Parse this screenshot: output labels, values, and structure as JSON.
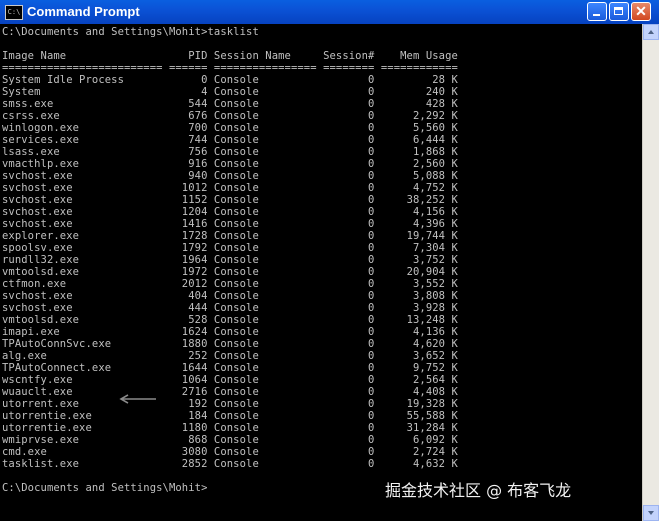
{
  "window": {
    "title": "Command Prompt",
    "icon_label": "C:\\",
    "icon": "cmd-icon"
  },
  "console": {
    "prompt_command": "C:\\Documents and Settings\\Mohit>tasklist",
    "blank": "",
    "header": "Image Name                   PID Session Name     Session#    Mem Usage",
    "separator": "========================= ====== ================ ======== ============",
    "rows": [
      {
        "image": "System Idle Process",
        "pid": "0",
        "session": "Console",
        "num": "0",
        "mem": "28 K"
      },
      {
        "image": "System",
        "pid": "4",
        "session": "Console",
        "num": "0",
        "mem": "240 K"
      },
      {
        "image": "smss.exe",
        "pid": "544",
        "session": "Console",
        "num": "0",
        "mem": "428 K"
      },
      {
        "image": "csrss.exe",
        "pid": "676",
        "session": "Console",
        "num": "0",
        "mem": "2,292 K"
      },
      {
        "image": "winlogon.exe",
        "pid": "700",
        "session": "Console",
        "num": "0",
        "mem": "5,560 K"
      },
      {
        "image": "services.exe",
        "pid": "744",
        "session": "Console",
        "num": "0",
        "mem": "6,444 K"
      },
      {
        "image": "lsass.exe",
        "pid": "756",
        "session": "Console",
        "num": "0",
        "mem": "1,868 K"
      },
      {
        "image": "vmacthlp.exe",
        "pid": "916",
        "session": "Console",
        "num": "0",
        "mem": "2,560 K"
      },
      {
        "image": "svchost.exe",
        "pid": "940",
        "session": "Console",
        "num": "0",
        "mem": "5,088 K"
      },
      {
        "image": "svchost.exe",
        "pid": "1012",
        "session": "Console",
        "num": "0",
        "mem": "4,752 K"
      },
      {
        "image": "svchost.exe",
        "pid": "1152",
        "session": "Console",
        "num": "0",
        "mem": "38,252 K"
      },
      {
        "image": "svchost.exe",
        "pid": "1204",
        "session": "Console",
        "num": "0",
        "mem": "4,156 K"
      },
      {
        "image": "svchost.exe",
        "pid": "1416",
        "session": "Console",
        "num": "0",
        "mem": "4,396 K"
      },
      {
        "image": "explorer.exe",
        "pid": "1728",
        "session": "Console",
        "num": "0",
        "mem": "19,744 K"
      },
      {
        "image": "spoolsv.exe",
        "pid": "1792",
        "session": "Console",
        "num": "0",
        "mem": "7,304 K"
      },
      {
        "image": "rundll32.exe",
        "pid": "1964",
        "session": "Console",
        "num": "0",
        "mem": "3,752 K"
      },
      {
        "image": "vmtoolsd.exe",
        "pid": "1972",
        "session": "Console",
        "num": "0",
        "mem": "20,904 K"
      },
      {
        "image": "ctfmon.exe",
        "pid": "2012",
        "session": "Console",
        "num": "0",
        "mem": "3,552 K"
      },
      {
        "image": "svchost.exe",
        "pid": "404",
        "session": "Console",
        "num": "0",
        "mem": "3,808 K"
      },
      {
        "image": "svchost.exe",
        "pid": "444",
        "session": "Console",
        "num": "0",
        "mem": "3,928 K"
      },
      {
        "image": "vmtoolsd.exe",
        "pid": "528",
        "session": "Console",
        "num": "0",
        "mem": "13,248 K"
      },
      {
        "image": "imapi.exe",
        "pid": "1624",
        "session": "Console",
        "num": "0",
        "mem": "4,136 K"
      },
      {
        "image": "TPAutoConnSvc.exe",
        "pid": "1880",
        "session": "Console",
        "num": "0",
        "mem": "4,620 K"
      },
      {
        "image": "alg.exe",
        "pid": "252",
        "session": "Console",
        "num": "0",
        "mem": "3,652 K"
      },
      {
        "image": "TPAutoConnect.exe",
        "pid": "1644",
        "session": "Console",
        "num": "0",
        "mem": "9,752 K"
      },
      {
        "image": "wscntfy.exe",
        "pid": "1064",
        "session": "Console",
        "num": "0",
        "mem": "2,564 K"
      },
      {
        "image": "wuauclt.exe",
        "pid": "2716",
        "session": "Console",
        "num": "0",
        "mem": "4,408 K"
      },
      {
        "image": "utorrent.exe",
        "pid": "192",
        "session": "Console",
        "num": "0",
        "mem": "19,328 K"
      },
      {
        "image": "utorrentie.exe",
        "pid": "184",
        "session": "Console",
        "num": "0",
        "mem": "55,588 K"
      },
      {
        "image": "utorrentie.exe",
        "pid": "1180",
        "session": "Console",
        "num": "0",
        "mem": "31,284 K"
      },
      {
        "image": "wmiprvse.exe",
        "pid": "868",
        "session": "Console",
        "num": "0",
        "mem": "6,092 K"
      },
      {
        "image": "cmd.exe",
        "pid": "3080",
        "session": "Console",
        "num": "0",
        "mem": "2,724 K"
      },
      {
        "image": "tasklist.exe",
        "pid": "2852",
        "session": "Console",
        "num": "0",
        "mem": "4,632 K"
      }
    ],
    "final_prompt": "C:\\Documents and Settings\\Mohit>"
  },
  "annotation": {
    "icon": "left-arrow-icon"
  },
  "watermark": "掘金技术社区 @ 布客飞龙",
  "colors": {
    "console_bg": "#000000",
    "console_text": "#c0c0c0",
    "titlebar": "#0b52d6",
    "title_text": "#ffffff",
    "close_button": "#d2471f"
  }
}
